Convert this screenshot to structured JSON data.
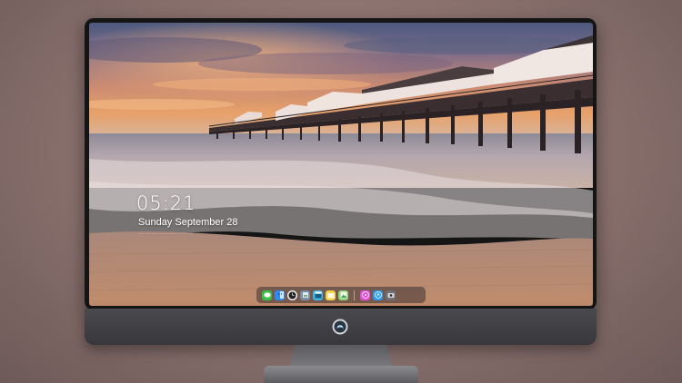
{
  "lock_screen": {
    "time": "05:21",
    "date": "Sunday September  28",
    "subline": "····· ···· ······ ·· ····· ······ ··· ···· ····"
  },
  "dock": {
    "apps": [
      {
        "name": "messages-app-icon",
        "color": "#39c24a"
      },
      {
        "name": "finder-app-icon",
        "color": "#2f8bf0"
      },
      {
        "name": "clock-app-icon",
        "color": "#f2f2f2"
      },
      {
        "name": "preview-app-icon",
        "color": "#7a8fa8"
      },
      {
        "name": "video-app-icon",
        "color": "#3fb7e8"
      },
      {
        "name": "notes-app-icon",
        "color": "#f6d24a"
      },
      {
        "name": "photos-app-icon",
        "color": "#8fd27a"
      },
      {
        "name": "music-app-icon",
        "color": "#e14fd8"
      },
      {
        "name": "app-store-icon",
        "color": "#2a9af3"
      },
      {
        "name": "camera-app-icon",
        "color": "#6f6f74"
      }
    ]
  },
  "colors": {
    "sky_top": "#4f5c80",
    "sky_glow": "#e89a62",
    "sand": "#b98d72"
  }
}
